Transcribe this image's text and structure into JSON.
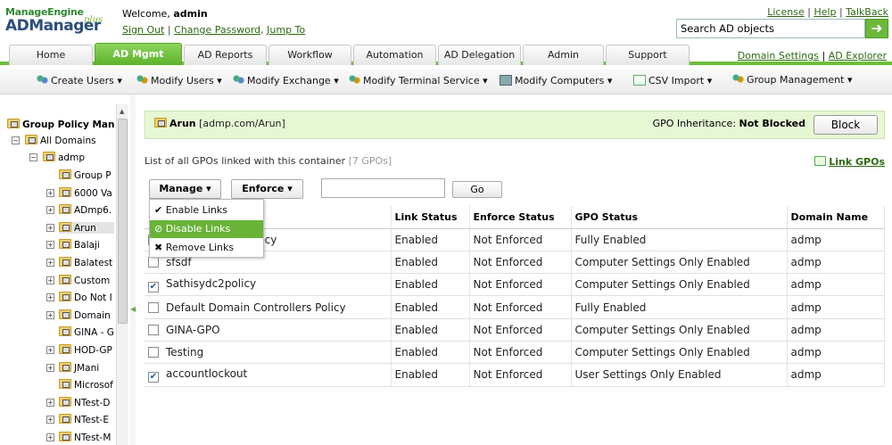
{
  "logo": {
    "brand": "ManageEngine",
    "product": "ADManager",
    "edition": "plus"
  },
  "header": {
    "welcome_label": "Welcome,",
    "username": "admin",
    "sign_out": "Sign Out",
    "change_password": "Change Password",
    "jump_to": "Jump To",
    "license": "License",
    "help": "Help",
    "talkback": "TalkBack",
    "search_value": "Search AD objects"
  },
  "tabs": [
    "Home",
    "AD Mgmt",
    "AD Reports",
    "Workflow",
    "Automation",
    "AD Delegation",
    "Admin",
    "Support"
  ],
  "active_tab": "AD Mgmt",
  "tab_links": {
    "domain_settings": "Domain Settings",
    "ad_explorer": "AD Explorer"
  },
  "submenu": [
    "Create Users",
    "Modify Users",
    "Modify Exchange",
    "Modify Terminal Service",
    "Modify Computers",
    "CSV Import",
    "Group Management"
  ],
  "sidebar": {
    "title": "Group Policy Mana",
    "root": "All Domains",
    "domain": "admp",
    "items": [
      "Group P",
      "6000 Va",
      "ADmp6.",
      "Arun",
      "Balaji",
      "Balatest",
      "Custom",
      "Do Not I",
      "Domain",
      "GINA - G",
      "HOD-GP",
      "JMani",
      "Microsof",
      "NTest-D",
      "NTest-E",
      "NTest-M"
    ]
  },
  "container": {
    "name": "Arun",
    "path": "[admp.com/Arun]",
    "inheritance_label": "GPO Inheritance:",
    "inheritance_value": "Not Blocked",
    "block_button": "Block"
  },
  "list": {
    "caption": "List of all GPOs linked with this container",
    "count": "[7 GPOs]",
    "link_gpos": "Link GPOs"
  },
  "toolbar": {
    "manage": "Manage",
    "enforce": "Enforce",
    "filter_value": "",
    "go": "Go"
  },
  "manage_menu": [
    "Enable Links",
    "Disable Links",
    "Remove Links"
  ],
  "table": {
    "columns": [
      "",
      "Link Status",
      "Enforce Status",
      "GPO Status",
      "Domain Name"
    ],
    "rows": [
      {
        "name": "licy",
        "checked": false,
        "link": "Enabled",
        "enforce": "Not Enforced",
        "status": "Fully Enabled",
        "domain": "admp"
      },
      {
        "name": "sfsdf",
        "checked": false,
        "link": "Enabled",
        "enforce": "Not Enforced",
        "status": "Computer Settings Only Enabled",
        "domain": "admp"
      },
      {
        "name": "Sathisydc2policy",
        "checked": true,
        "link": "Enabled",
        "enforce": "Not Enforced",
        "status": "Computer Settings Only Enabled",
        "domain": "admp"
      },
      {
        "name": "Default Domain Controllers Policy",
        "checked": false,
        "link": "Enabled",
        "enforce": "Not Enforced",
        "status": "Fully Enabled",
        "domain": "admp"
      },
      {
        "name": "GINA-GPO",
        "checked": false,
        "link": "Enabled",
        "enforce": "Not Enforced",
        "status": "Computer Settings Only Enabled",
        "domain": "admp"
      },
      {
        "name": "Testing",
        "checked": false,
        "link": "Enabled",
        "enforce": "Not Enforced",
        "status": "Computer Settings Only Enabled",
        "domain": "admp"
      },
      {
        "name": "accountlockout",
        "checked": true,
        "link": "Enabled",
        "enforce": "Not Enforced",
        "status": "User Settings Only Enabled",
        "domain": "admp"
      }
    ]
  },
  "colors": {
    "accent": "#6ebe3a",
    "link": "#2d6a12",
    "banner": "#e6f7d4",
    "highlight": "#69b338"
  }
}
